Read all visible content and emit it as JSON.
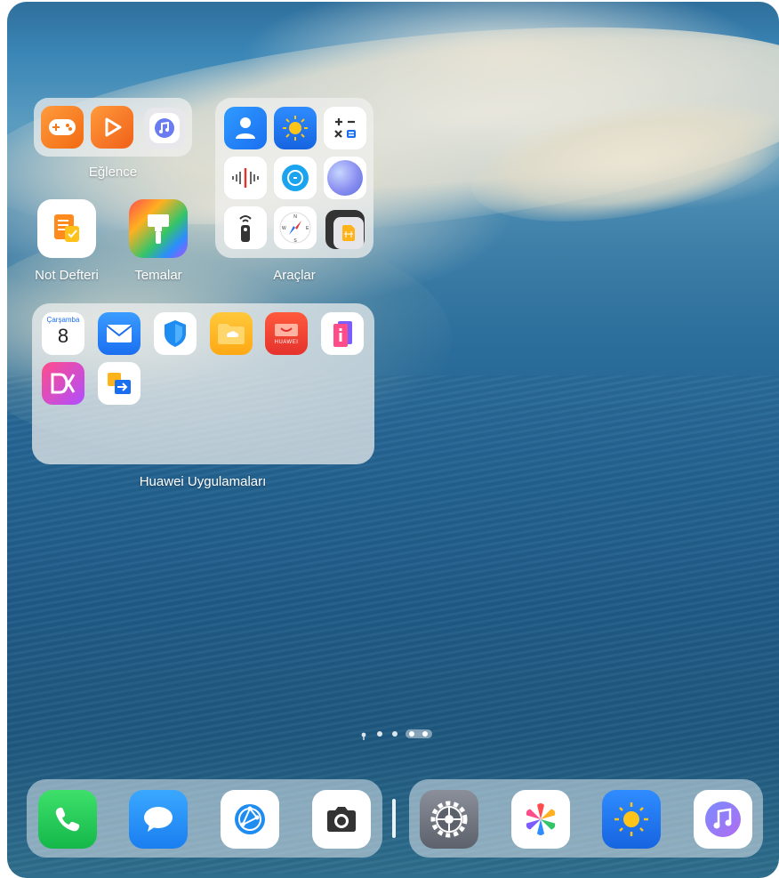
{
  "folders": {
    "entertainment": {
      "label": "Eğlence"
    },
    "tools": {
      "label": "Araçlar"
    },
    "huawei": {
      "label": "Huawei Uygulamaları"
    }
  },
  "apps": {
    "notes": {
      "label": "Not Defteri"
    },
    "themes": {
      "label": "Temalar"
    }
  },
  "calendar": {
    "weekday": "Çarşamba",
    "day": "8"
  },
  "huawei_store_badge": "HUAWEI",
  "page_indicator": {
    "total": 5,
    "current": 4
  },
  "dock": {
    "left": [
      "phone",
      "messages",
      "browser",
      "camera"
    ],
    "right": [
      "settings",
      "gallery",
      "weather",
      "music"
    ]
  }
}
